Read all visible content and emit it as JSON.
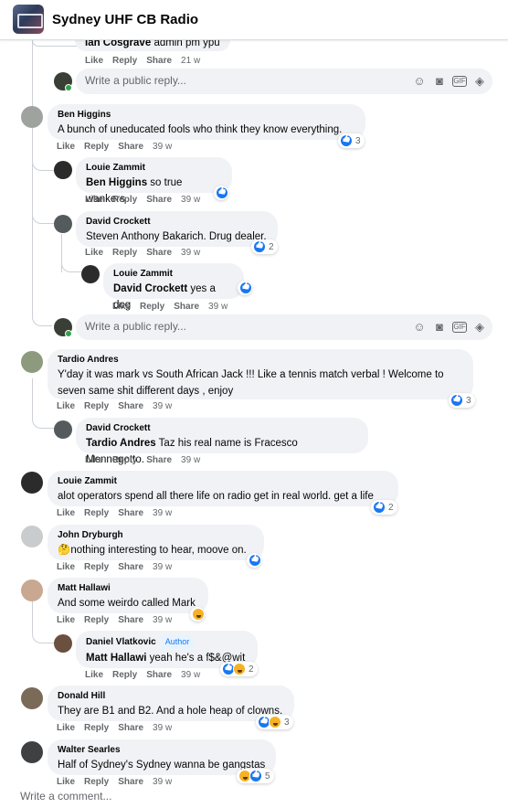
{
  "header": {
    "title": "Sydney UHF CB Radio"
  },
  "reply_placeholder": "Write a public reply...",
  "comment_placeholder": "Write a comment...",
  "actions": {
    "like": "Like",
    "reply": "Reply",
    "share": "Share"
  },
  "author_badge": "Author",
  "comments": [
    {
      "id": "c0",
      "name": "Ian Cosgrave",
      "text": "admin pm ypu",
      "time": "21 w"
    },
    {
      "id": "c1",
      "name": "Ben Higgins",
      "text": "A bunch of uneducated fools who think they know everything.",
      "time": "39 w",
      "reactions": [
        "like"
      ],
      "reaction_count": "3"
    },
    {
      "id": "c2",
      "name": "Louie Zammit",
      "mention": "Ben Higgins",
      "text": " so true wankers",
      "time": "39 w",
      "reactions": [
        "like"
      ]
    },
    {
      "id": "c3",
      "name": "David Crockett",
      "text": "Steven Anthony Bakarich. Drug dealer.",
      "time": "39 w",
      "reactions": [
        "like"
      ],
      "reaction_count": "2"
    },
    {
      "id": "c4",
      "name": "Louie Zammit",
      "mention": "David Crockett",
      "text": " yes a dog",
      "time": "39 w",
      "reactions": [
        "like"
      ]
    },
    {
      "id": "c5",
      "name": "Tardio Andres",
      "text": "Y'day it was mark vs South African Jack !!! Like a tennis match verbal ! Welcome to seven same shit different days , enjoy",
      "time": "39 w",
      "reactions": [
        "like"
      ],
      "reaction_count": "3"
    },
    {
      "id": "c6",
      "name": "David Crockett",
      "mention": "Tardio Andres",
      "text": " Taz his real name is Fracesco Mennegotto.",
      "time": "39 w"
    },
    {
      "id": "c7",
      "name": "Louie Zammit",
      "text": "alot operators spend all there life on radio get in real world. get a life",
      "time": "39 w",
      "reactions": [
        "like"
      ],
      "reaction_count": "2"
    },
    {
      "id": "c8",
      "name": "John Dryburgh",
      "text": "🤔nothing interesting to hear, moove on.",
      "time": "39 w",
      "reactions": [
        "like"
      ]
    },
    {
      "id": "c9",
      "name": "Matt Hallawi",
      "text": "And some weirdo called Mark",
      "time": "39 w",
      "reactions": [
        "haha"
      ]
    },
    {
      "id": "c10",
      "name": "Daniel Vlatkovic",
      "mention": "Matt Hallawi",
      "text": " yeah he's a f$&@wit",
      "time": "39 w",
      "author": true,
      "reactions": [
        "like",
        "haha"
      ],
      "reaction_count": "2"
    },
    {
      "id": "c11",
      "name": "Donald Hill",
      "text": "They are B1 and B2. And a hole heap of clowns.",
      "time": "39 w",
      "reactions": [
        "like",
        "haha"
      ],
      "reaction_count": "3"
    },
    {
      "id": "c12",
      "name": "Walter Searles",
      "text": "Half of Sydney's Sydney wanna be gangstas",
      "time": "39 w",
      "reactions": [
        "haha",
        "like"
      ],
      "reaction_count": "5"
    }
  ],
  "colors": {
    "like": "#1877f2",
    "haha": "#f7b125",
    "bubble": "#f0f2f5",
    "meta": "#65676b"
  }
}
